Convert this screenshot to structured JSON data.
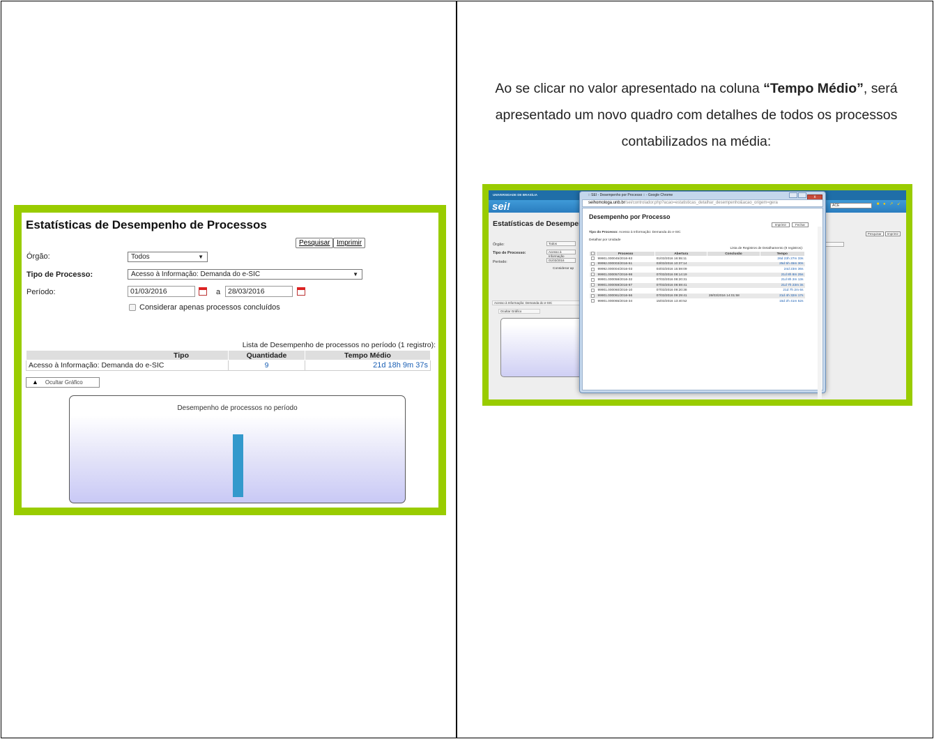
{
  "left_screenshot": {
    "title": "Estatísticas de Desempenho de Processos",
    "buttons": {
      "pesquisar": "Pesquisar",
      "imprimir": "Imprimir"
    },
    "orgao": {
      "label": "Órgão:",
      "value": "Todos"
    },
    "tipo_processo": {
      "label": "Tipo de Processo:",
      "value": "Acesso à Informação: Demanda do e-SIC"
    },
    "periodo": {
      "label": "Período:",
      "from": "01/03/2016",
      "sep": "a",
      "to": "28/03/2016"
    },
    "checkbox_label": "Considerar apenas processos concluídos",
    "caption": "Lista de Desempenho de processos no período (1 registro):",
    "table": {
      "headers": [
        "Tipo",
        "Quantidade",
        "Tempo Médio"
      ],
      "rows": [
        {
          "tipo": "Acesso à Informação: Demanda do e-SIC",
          "quantidade": "9",
          "tempo": "21d 18h 9m 37s"
        }
      ]
    },
    "hide_chart_label": "Ocultar Gráfico",
    "chart": {
      "title": "Desempenho de processos no período"
    },
    "chart_data": {
      "type": "bar",
      "title": "Desempenho de processos no período",
      "categories": [
        "Acesso à Informação: Demanda do e-SIC"
      ],
      "values": [
        21.76
      ]
    }
  },
  "right_text": {
    "part1": "Ao se clicar no valor apresentado na coluna ",
    "bold": "“Tempo Médio”",
    "part2": ", será apresentado um novo quadro com detalhes de todos os processos contabilizados na média:"
  },
  "right_screenshot": {
    "bg_university": "UNIVERSIDADE DE BRASÍLIA",
    "bg_logo": "sei!",
    "bg_title": "Estatísticas de Desempenho",
    "bg_labels": {
      "orgao": "Órgão:",
      "tipo": "Tipo de Processo:",
      "periodo": "Período:"
    },
    "bg_values": {
      "orgao": "Todos",
      "tipo": "Acesso à Informação",
      "periodo": "01/03/2016"
    },
    "bg_considerar": "Considerar ap",
    "bg_row": "Acesso à Informação: Demanda do e-SIC",
    "bg_hide": "Ocultar Gráfico",
    "bg_ace": "ACE",
    "bg_buttons": [
      "Pesquisar",
      "Imprimir"
    ],
    "popup": {
      "window_title": ":: SEI - Desempenho por Processo :: - Google Chrome",
      "url_host": "seihomologa.unb.br",
      "url_path": "/sei/controlador.php?acao=estatisticas_detalhar_desempenho&acao_origem=gera",
      "title": "Desempenho por Processo",
      "buttons": [
        "Imprimir",
        "Fechar"
      ],
      "tipo_label": "Tipo do Processo:",
      "tipo_value": "Acesso à Informação: Demanda do e-SIC",
      "detalhar": "Detalhar por Unidade",
      "caption": "Lista de Registros de Detalhamento (9 registros):",
      "headers": [
        "Processo",
        "Abertura",
        "Conclusão",
        "Tempo"
      ],
      "rows": [
        {
          "processo": "99901.000045/2016-63",
          "abertura": "01/03/2016 16:55:11",
          "conclusao": "",
          "tempo": "26d 23h 27m 33s"
        },
        {
          "processo": "99992.000003/2016-51",
          "abertura": "03/03/2016 10:37:14",
          "conclusao": "",
          "tempo": "25d 5h 45m 30s"
        },
        {
          "processo": "99992.000004/2016-03",
          "abertura": "04/03/2016 15:59:09",
          "conclusao": "",
          "tempo": "24d 23m 36s"
        },
        {
          "processo": "99901.000057/2016-98",
          "abertura": "07/03/2016 08:14:19",
          "conclusao": "",
          "tempo": "21d 8h 8m 25s"
        },
        {
          "processo": "99901.000058/2016-32",
          "abertura": "07/03/2016 08:20:31",
          "conclusao": "",
          "tempo": "21d 8h 2m 13s"
        },
        {
          "processo": "99901.000059/2016-87",
          "abertura": "07/03/2016 08:59:41",
          "conclusao": "",
          "tempo": "21d 7h 23m 3s"
        },
        {
          "processo": "99901.000060/2016-10",
          "abertura": "07/03/2016 09:20:38",
          "conclusao": "",
          "tempo": "21d 7h 2m 6s"
        },
        {
          "processo": "99901.000061/2016-56",
          "abertura": "07/03/2016 09:29:41",
          "conclusao": "28/03/2016 14:01:58",
          "tempo": "21d 4h 32m 17s"
        },
        {
          "processo": "99901.000065/2016-34",
          "abertura": "15/03/2016 13:40:52",
          "conclusao": "",
          "tempo": "15d 2h 41m 52s"
        }
      ]
    }
  }
}
